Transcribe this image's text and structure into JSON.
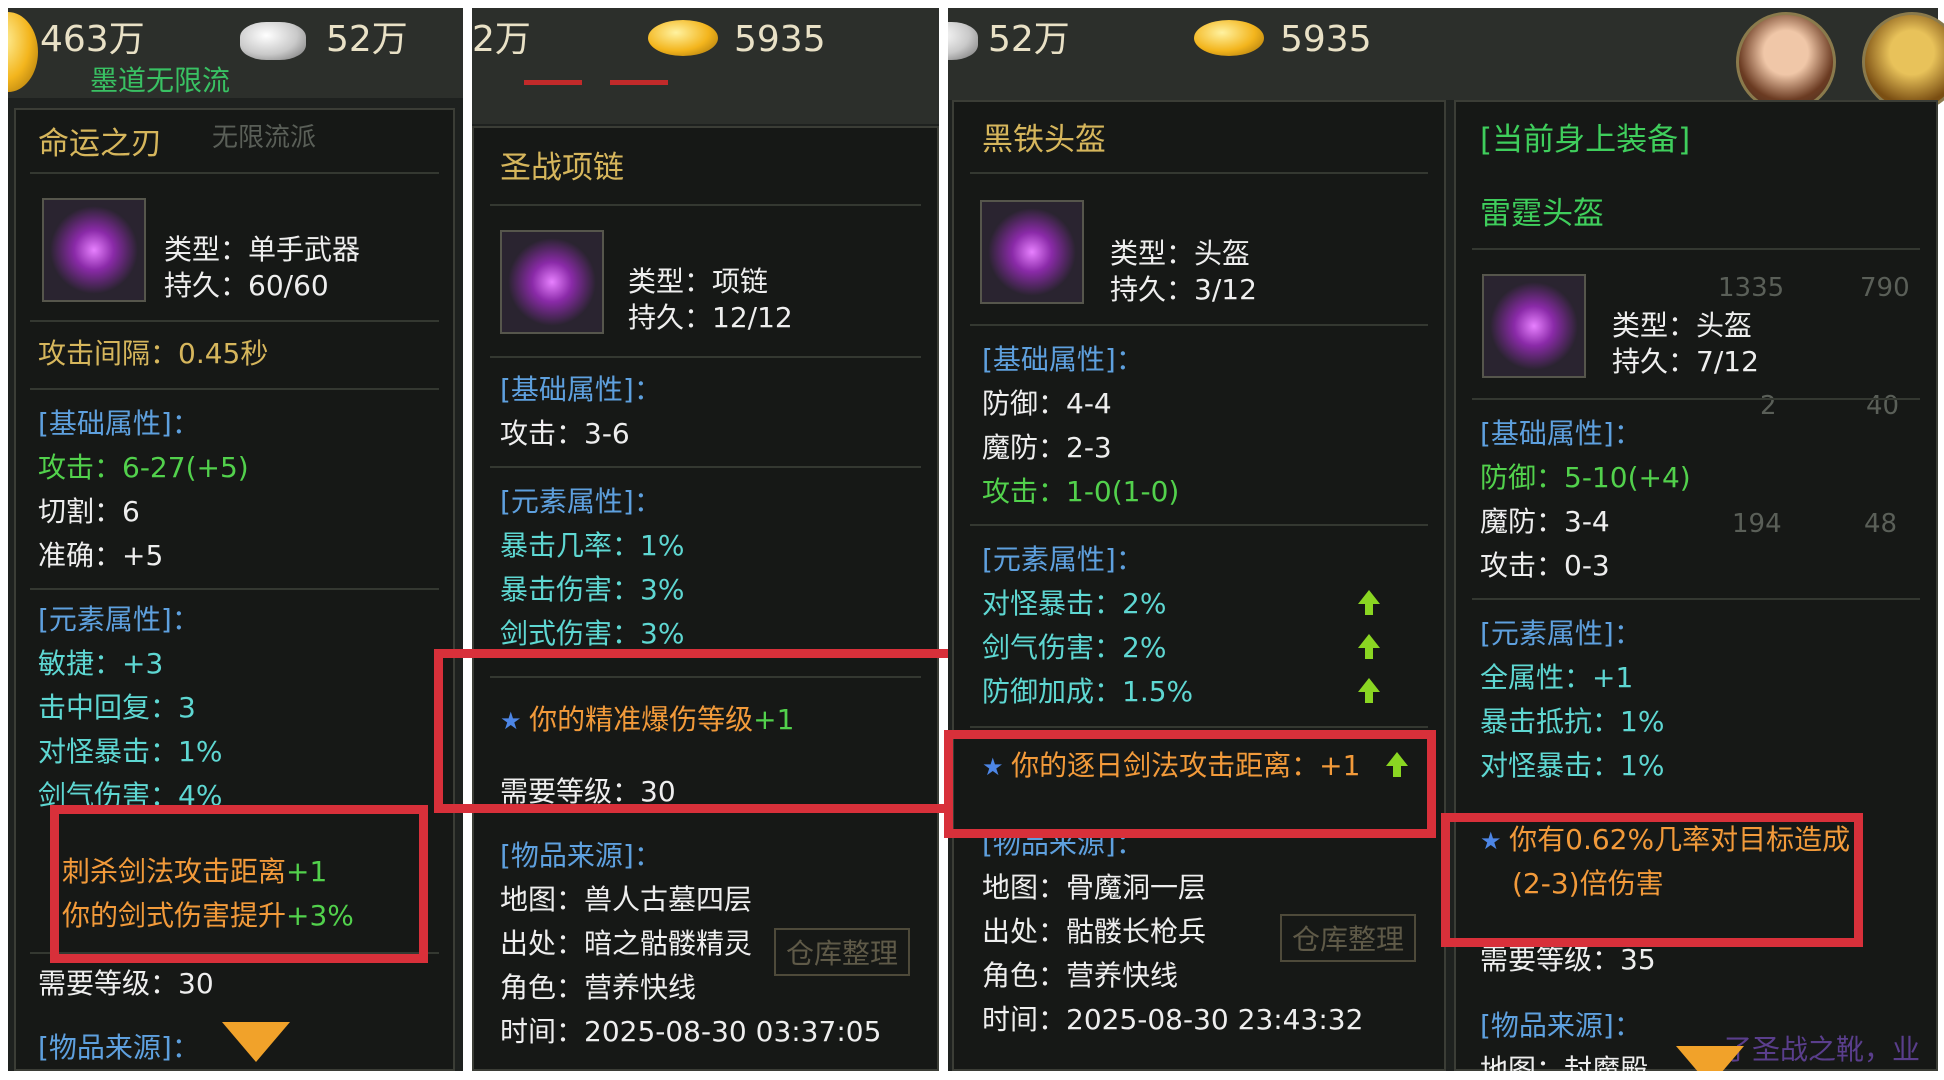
{
  "panel1": {
    "gold": "463万",
    "silver": "52万",
    "guild": "墨道无限流",
    "tab_faded": "无限流派",
    "item_name": "命运之刃",
    "type": "类型：单手武器",
    "durability": "持久：60/60",
    "attack_interval": "攻击间隔：0.45秒",
    "base_header": "[基础属性]：",
    "attack_label": "攻击：6-27",
    "attack_bonus": "(+5)",
    "cut": "切割：6",
    "accuracy": "准确：+5",
    "element_header": "[元素属性]：",
    "agility": "敏捷：+3",
    "hit_recover": "击中回复：3",
    "monster_crit": "对怪暴击：1%",
    "sword_damage": "剑气伤害：4%",
    "special_1": "刺杀剑法攻击距离",
    "special_1_bonus": "+1",
    "special_2": "你的剑式伤害提升",
    "special_2_bonus": "+3%",
    "required_level": "需要等级：30",
    "source_header": "[物品来源]："
  },
  "panel2": {
    "gold": "2万",
    "ingot": "5935",
    "item_name": "圣战项链",
    "type": "类型：项链",
    "durability": "持久：12/12",
    "base_header": "[基础属性]：",
    "attack": "攻击：3-6",
    "element_header": "[元素属性]：",
    "crit_rate": "暴击几率：1%",
    "crit_damage": "暴击伤害：3%",
    "sword_style_damage": "剑式伤害：3%",
    "special": "你的精准爆伤等级",
    "special_bonus": "+1",
    "required_level": "需要等级：30",
    "source_header": "[物品来源]：",
    "map": "地图：兽人古墓四层",
    "origin": "出处：暗之骷髅精灵",
    "role": "角色：营养快线",
    "time": "时间：2025-08-30 03:37:05",
    "storage_button": "仓库整理"
  },
  "panel3": {
    "silver": "52万",
    "ingot": "5935",
    "item_name": "黑铁头盔",
    "type": "类型：头盔",
    "durability": "持久：3/12",
    "base_header": "[基础属性]：",
    "defense": "防御：4-4",
    "magic_defense": "魔防：2-3",
    "attack_label": "攻击：1-0",
    "attack_bonus": "(1-0)",
    "element_header": "[元素属性]：",
    "monster_crit": "对怪暴击：2%",
    "sword_qi_damage": "剑气伤害：2%",
    "defense_bonus": "防御加成：1.5%",
    "special": "你的逐日剑法攻击距离：+1",
    "source_header": "[物品来源]：",
    "map": "地图：骨魔洞一层",
    "origin": "出处：骷髅长枪兵",
    "role": "角色：营养快线",
    "time": "时间：2025-08-30 23:43:32",
    "storage_button": "仓库整理"
  },
  "panel4": {
    "equipped_header": "[当前身上装备]",
    "item_name": "雷霆头盔",
    "type": "类型：头盔",
    "durability": "持久：7/12",
    "bg_numbers": [
      "1335",
      "790",
      "2",
      "40",
      "194",
      "48"
    ],
    "base_header": "[基础属性]：",
    "defense_label": "防御：5-10",
    "defense_bonus": "(+4)",
    "magic_defense": "魔防：3-4",
    "attack": "攻击：0-3",
    "element_header": "[元素属性]：",
    "all_attributes": "全属性：+1",
    "crit_resist": "暴击抵抗：1%",
    "monster_crit": "对怪暴击：1%",
    "special_line1": "你有0.62%几率对目标造成",
    "special_line2": "(2-3)倍伤害",
    "required_level": "需要等级：35",
    "source_header": "[物品来源]：",
    "map_partial": "地图：封魔殿",
    "bg_text": "了圣战之靴，业"
  },
  "colors": {
    "highlight_box": "#d8303a",
    "section": "#5ea0de",
    "bonus": "#52d14c",
    "element": "#5ed7d2",
    "special": "#f29a3a",
    "title": "#d6b65c"
  }
}
